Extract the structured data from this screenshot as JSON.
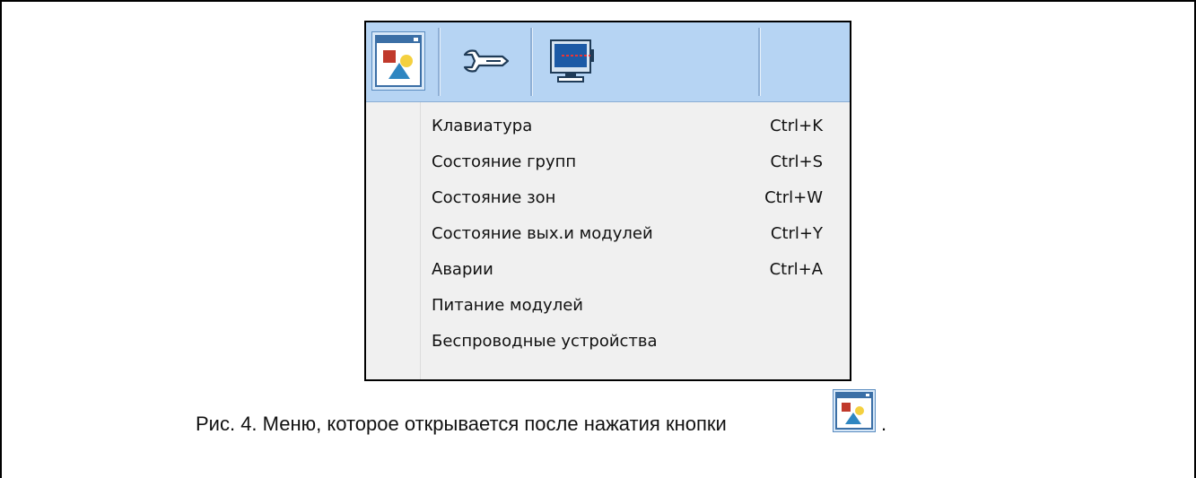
{
  "toolbar": {
    "buttons": [
      {
        "icon": "window-image-icon"
      },
      {
        "icon": "wrench-icon"
      },
      {
        "icon": "monitor-icon"
      }
    ]
  },
  "menu": {
    "items": [
      {
        "label": "Клавиатура",
        "shortcut": "Ctrl+K"
      },
      {
        "label": "Состояние групп",
        "shortcut": "Ctrl+S"
      },
      {
        "label": "Состояние зон",
        "shortcut": "Ctrl+W"
      },
      {
        "label": "Состояние вых.и модулей",
        "shortcut": "Ctrl+Y"
      },
      {
        "label": "Аварии",
        "shortcut": "Ctrl+A"
      },
      {
        "label": "Питание модулей",
        "shortcut": ""
      },
      {
        "label": "Беспроводные устройства",
        "shortcut": ""
      }
    ]
  },
  "caption": {
    "text": "Рис. 4. Меню, которое открывается после нажатия кнопки",
    "end": "."
  }
}
